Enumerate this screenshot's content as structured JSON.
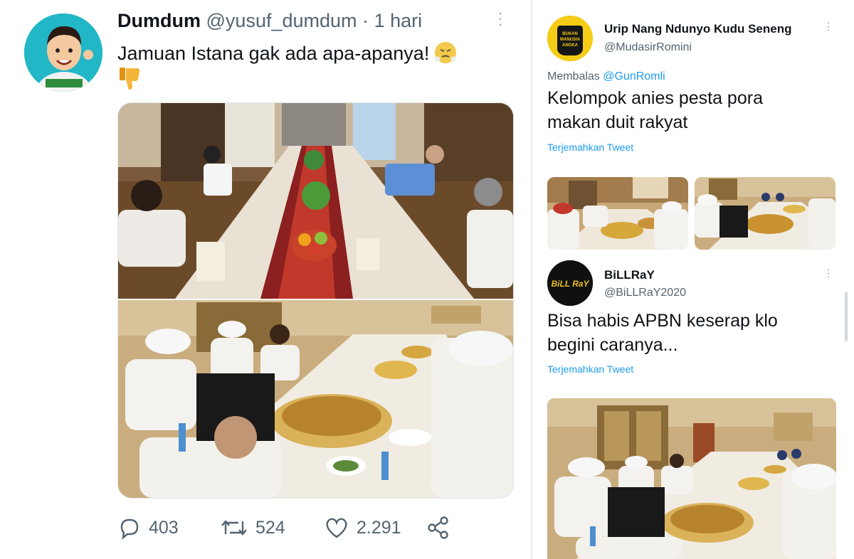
{
  "main_tweet": {
    "display_name": "Dumdum",
    "handle": "@yusuf_dumdum",
    "separator": "·",
    "time": "1 hari",
    "text": "Jamuan Istana gak ada apa-apanya!",
    "emoji_angry": "face-steam-icon",
    "emoji_thumbs": "thumbs-down-icon",
    "stats": {
      "replies": "403",
      "retweets": "524",
      "likes": "2.291"
    }
  },
  "reply_1": {
    "display_name": "Urip Nang Ndunyo Kudu Seneng",
    "handle": "@MudasirRomini",
    "avatar_text": "BUKAN MANUSIA ANGKA",
    "replying_prefix": "Membalas",
    "replying_to": "@GunRomli",
    "text_line1": "Kelompok anies pesta pora",
    "text_line2": "makan duit rakyat",
    "translate": "Terjemahkan Tweet"
  },
  "reply_2": {
    "display_name": "BiLLRaY",
    "handle": "@BiLLRaY2020",
    "avatar_text": "BiLL RaY",
    "text_line1": "Bisa habis APBN keserap klo",
    "text_line2": "begini caranya...",
    "translate": "Terjemahkan Tweet"
  },
  "colors": {
    "link": "#1d9bf0",
    "secondary_text": "#536471",
    "avatar_teal": "#22b7c7",
    "avatar_yellow": "#f5cc16"
  }
}
